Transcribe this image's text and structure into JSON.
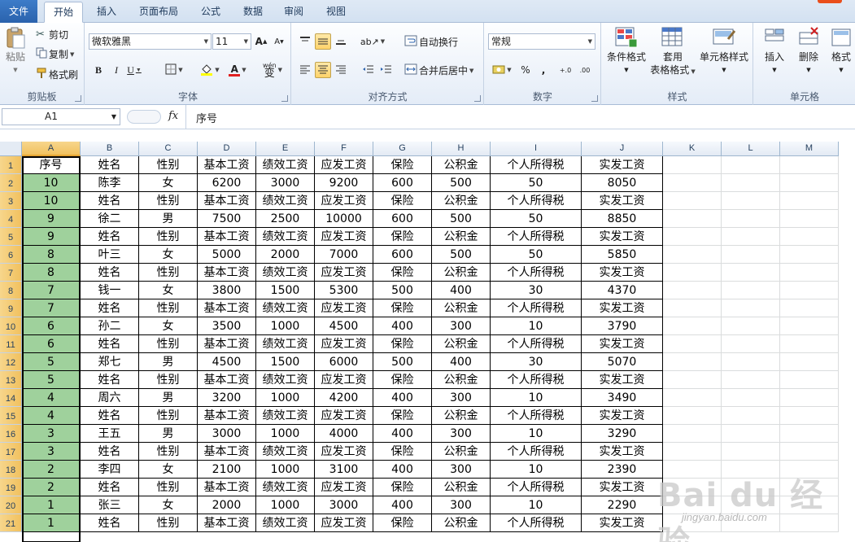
{
  "tabs": {
    "file": "文件",
    "home": "开始",
    "insert": "插入",
    "page_layout": "页面布局",
    "formulas": "公式",
    "data": "数据",
    "review": "审阅",
    "view": "视图"
  },
  "ribbon": {
    "clipboard": {
      "label": "剪贴板",
      "paste": "粘贴",
      "cut": "剪切",
      "copy": "复制",
      "format_painter": "格式刷"
    },
    "font": {
      "label": "字体",
      "font_name": "微软雅黑",
      "font_size": "11",
      "grow": "A",
      "shrink": "A",
      "bold": "B",
      "italic": "I",
      "underline": "U",
      "font_color": "A",
      "phonetic": "wén",
      "phonetic_char": "变"
    },
    "alignment": {
      "label": "对齐方式",
      "wrap_text": "自动换行",
      "merge_center": "合并后居中"
    },
    "number": {
      "label": "数字",
      "format": "常规",
      "percent": "%",
      "comma": ",",
      "inc_decimal": "+.0",
      "dec_decimal": ".00"
    },
    "styles": {
      "label": "样式",
      "conditional": "条件格式",
      "table_line1": "套用",
      "table_line2": "表格格式",
      "cell_styles": "单元格样式"
    },
    "cells": {
      "label": "单元格",
      "insert": "插入",
      "delete": "删除",
      "format": "格式"
    }
  },
  "formula_bar": {
    "name_box": "A1",
    "fx": "fx",
    "value": "序号"
  },
  "colors": {
    "selected_header": "#f1c15f",
    "col_a_fill": "#9fd19c",
    "accent": "#2a62ad"
  },
  "columns": [
    "A",
    "B",
    "C",
    "D",
    "E",
    "F",
    "G",
    "H",
    "I",
    "J",
    "K",
    "L",
    "M"
  ],
  "rows": [
    [
      "序号",
      "姓名",
      "性别",
      "基本工资",
      "绩效工资",
      "应发工资",
      "保险",
      "公积金",
      "个人所得税",
      "实发工资"
    ],
    [
      "10",
      "陈李",
      "女",
      "6200",
      "3000",
      "9200",
      "600",
      "500",
      "50",
      "8050"
    ],
    [
      "10",
      "姓名",
      "性别",
      "基本工资",
      "绩效工资",
      "应发工资",
      "保险",
      "公积金",
      "个人所得税",
      "实发工资"
    ],
    [
      "9",
      "徐二",
      "男",
      "7500",
      "2500",
      "10000",
      "600",
      "500",
      "50",
      "8850"
    ],
    [
      "9",
      "姓名",
      "性别",
      "基本工资",
      "绩效工资",
      "应发工资",
      "保险",
      "公积金",
      "个人所得税",
      "实发工资"
    ],
    [
      "8",
      "叶三",
      "女",
      "5000",
      "2000",
      "7000",
      "600",
      "500",
      "50",
      "5850"
    ],
    [
      "8",
      "姓名",
      "性别",
      "基本工资",
      "绩效工资",
      "应发工资",
      "保险",
      "公积金",
      "个人所得税",
      "实发工资"
    ],
    [
      "7",
      "钱一",
      "女",
      "3800",
      "1500",
      "5300",
      "500",
      "400",
      "30",
      "4370"
    ],
    [
      "7",
      "姓名",
      "性别",
      "基本工资",
      "绩效工资",
      "应发工资",
      "保险",
      "公积金",
      "个人所得税",
      "实发工资"
    ],
    [
      "6",
      "孙二",
      "女",
      "3500",
      "1000",
      "4500",
      "400",
      "300",
      "10",
      "3790"
    ],
    [
      "6",
      "姓名",
      "性别",
      "基本工资",
      "绩效工资",
      "应发工资",
      "保险",
      "公积金",
      "个人所得税",
      "实发工资"
    ],
    [
      "5",
      "郑七",
      "男",
      "4500",
      "1500",
      "6000",
      "500",
      "400",
      "30",
      "5070"
    ],
    [
      "5",
      "姓名",
      "性别",
      "基本工资",
      "绩效工资",
      "应发工资",
      "保险",
      "公积金",
      "个人所得税",
      "实发工资"
    ],
    [
      "4",
      "周六",
      "男",
      "3200",
      "1000",
      "4200",
      "400",
      "300",
      "10",
      "3490"
    ],
    [
      "4",
      "姓名",
      "性别",
      "基本工资",
      "绩效工资",
      "应发工资",
      "保险",
      "公积金",
      "个人所得税",
      "实发工资"
    ],
    [
      "3",
      "王五",
      "男",
      "3000",
      "1000",
      "4000",
      "400",
      "300",
      "10",
      "3290"
    ],
    [
      "3",
      "姓名",
      "性别",
      "基本工资",
      "绩效工资",
      "应发工资",
      "保险",
      "公积金",
      "个人所得税",
      "实发工资"
    ],
    [
      "2",
      "李四",
      "女",
      "2100",
      "1000",
      "3100",
      "400",
      "300",
      "10",
      "2390"
    ],
    [
      "2",
      "姓名",
      "性别",
      "基本工资",
      "绩效工资",
      "应发工资",
      "保险",
      "公积金",
      "个人所得税",
      "实发工资"
    ],
    [
      "1",
      "张三",
      "女",
      "2000",
      "1000",
      "3000",
      "400",
      "300",
      "10",
      "2290"
    ],
    [
      "1",
      "姓名",
      "性别",
      "基本工资",
      "绩效工资",
      "应发工资",
      "保险",
      "公积金",
      "个人所得税",
      "实发工资"
    ]
  ],
  "watermark": {
    "logo": "Bai du 经验",
    "url": "jingyan.baidu.com"
  }
}
